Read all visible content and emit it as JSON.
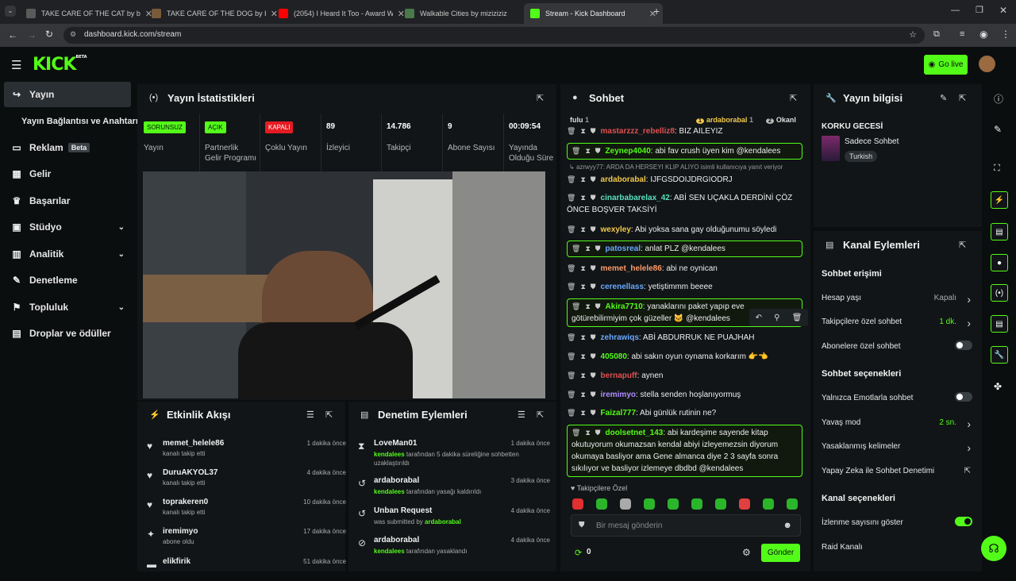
{
  "browser": {
    "tabs": [
      {
        "title": "TAKE CARE OF THE CAT by bo…",
        "color": "#5a5a5a"
      },
      {
        "title": "TAKE CARE OF THE DOG by bo…",
        "color": "#7a5a3a"
      },
      {
        "title": "(2054) I Heard It Too - Award W…",
        "color": "#ff0000"
      },
      {
        "title": "Walkable Cities by miziziziz",
        "color": "#4a7a4a"
      },
      {
        "title": "Stream - Kick Dashboard",
        "color": "#53fc18"
      }
    ],
    "url": "dashboard.kick.com/stream"
  },
  "header": {
    "logo": "KICK",
    "logo_beta": "BETA",
    "go_live": "Go live"
  },
  "sidebar": {
    "items": [
      {
        "label": "Yayın",
        "icon": "↪"
      },
      {
        "label": "Yayın Bağlantısı ve Anahtarı",
        "icon": ""
      },
      {
        "label": "Reklam",
        "icon": "▭",
        "badge": "Beta"
      },
      {
        "label": "Gelir",
        "icon": "▦"
      },
      {
        "label": "Başarılar",
        "icon": "♛"
      },
      {
        "label": "Stüdyo",
        "icon": "▣"
      },
      {
        "label": "Analitik",
        "icon": "▥"
      },
      {
        "label": "Denetleme",
        "icon": "✎"
      },
      {
        "label": "Topluluk",
        "icon": "⚑"
      },
      {
        "label": "Droplar ve ödüller",
        "icon": "▤"
      }
    ]
  },
  "stats": {
    "title": "Yayın İstatistikleri",
    "items": [
      {
        "badge": "SORUNSUZ",
        "label": "Yayın"
      },
      {
        "badge": "AÇIK",
        "label": "Partnerlik Gelir Programı"
      },
      {
        "badge": "KAPALI",
        "label": "Çoklu Yayın"
      },
      {
        "value": "89",
        "label": "İzleyici"
      },
      {
        "value": "14.786",
        "label": "Takipçi"
      },
      {
        "value": "9",
        "label": "Abone Sayısı"
      },
      {
        "value": "00:09:54",
        "label": "Yayında Olduğu Süre"
      }
    ]
  },
  "activity": {
    "title": "Etkinlik Akışı",
    "items": [
      {
        "icon": "♥",
        "name": "memet_helele86",
        "sub": "kanalı takip etti",
        "time": "1 dakika önce"
      },
      {
        "icon": "♥",
        "name": "DuruAKYOL37",
        "sub": "kanalı takip etti",
        "time": "4 dakika önce"
      },
      {
        "icon": "♥",
        "name": "toprakeren0",
        "sub": "kanalı takip etti",
        "time": "10 dakika önce"
      },
      {
        "icon": "✦",
        "name": "iremimyo",
        "sub": "abone oldu",
        "time": "17 dakika önce"
      },
      {
        "icon": "▬",
        "name": "elikfirik",
        "sub": "",
        "time": "51 dakika önce"
      }
    ]
  },
  "moderation": {
    "title": "Denetim Eylemleri",
    "items": [
      {
        "icon": "⧗",
        "name": "LoveMan01",
        "mod": "kendalees",
        "text": " tarafından 5 dakika süreliğine sohbetten uzaklaştırıldı",
        "time": "1 dakika önce"
      },
      {
        "icon": "↺",
        "name": "ardaborabal",
        "mod": "kendalees",
        "text": " tarafından yasağı kaldırıldı",
        "time": "3 dakika önce"
      },
      {
        "icon": "↺",
        "name": "Unban Request",
        "mod": "ardaborabal",
        "pre": "was submitted by ",
        "text": "",
        "time": "4 dakika önce"
      },
      {
        "icon": "⊘",
        "name": "ardaborabal",
        "mod": "kendalees",
        "text": " tarafından yasaklandı",
        "time": "4 dakika önce"
      }
    ]
  },
  "chat": {
    "title": "Sohbet",
    "top_user": "fulu",
    "top_count": "1",
    "gift1": "ardaborabal",
    "gift1_count": "1",
    "gift2": "Okanl",
    "reply_notice": "azrwyy77: ARDA DA HERSEYI KLIP ALIYO isimli kullanıcıya yanıt veriyor",
    "messages": [
      {
        "user": "mastarzzz_rebelliz8",
        "color": "#e05050",
        "text": ": BIZ AILEYIZ"
      },
      {
        "user": "Zeynep4040",
        "color": "#53fc18",
        "text": ": abi fav crush üyen kim @kendalees",
        "hl": true
      },
      {
        "user": "ardaborabal",
        "color": "#f2c94c",
        "text": ": IJFGSDOIJDRGIODRJ"
      },
      {
        "user": "cinarbabarelax_42",
        "color": "#5ae0c0",
        "text": ": ABİ SEN UÇAKLA DERDİNİ ÇÖZ ÖNCE BOŞVER TAKSİYİ"
      },
      {
        "user": "wexyley",
        "color": "#f2c94c",
        "text": ": Abi yoksa sana gay olduğunumu söyledi"
      },
      {
        "user": "patosreal",
        "color": "#6aa8ff",
        "text": ": anlat PLZ @kendalees",
        "hl": true
      },
      {
        "user": "memet_helele86",
        "color": "#ff9a6a",
        "text": ": abi ne oynican"
      },
      {
        "user": "cerenellass",
        "color": "#6aa8ff",
        "text": ": yetiştimmm beeee"
      },
      {
        "user": "Akira7710",
        "color": "#53fc18",
        "text": ": yanaklarını paket yapıp eve götürebilirmiyim çok güzeller 🐱 @kendalees",
        "hl": true
      },
      {
        "user": "zehrawiqs",
        "color": "#6aa8ff",
        "text": ": ABİ ABDURRUK NE PUAJHAH"
      },
      {
        "user": "405080",
        "color": "#53fc18",
        "text": ": abi sakın oyun oynama korkarım 👉👈"
      },
      {
        "user": "bernapuff",
        "color": "#e05050",
        "text": ": aynen"
      },
      {
        "user": "iremimyo",
        "color": "#b08cff",
        "text": ": stella senden hoşlanıyormuş"
      },
      {
        "user": "Faizal777",
        "color": "#53fc18",
        "text": ": Abi günlük rutinin ne?"
      },
      {
        "user": "doolsetnet_143",
        "color": "#53fc18",
        "text": ": abi kardeşime sayende kitap okutuyorum okumazsan kendal abiyi izleyemezsin diyorum okumaya basliyor ama Gene almanca diye 2 3 sayfa sonra sıkılıyor ve basliyor izlemeye dbdbd @kendalees",
        "hl": true
      }
    ],
    "followers_only": "Takipçilere Özel",
    "input_placeholder": "Bir mesaj gönderin",
    "points": "0",
    "send": "Gönder"
  },
  "stream_info": {
    "title": "Yayın bilgisi",
    "stream_title": "KORKU GECESİ",
    "category": "Sadece Sohbet",
    "tag": "Turkish"
  },
  "channel_actions": {
    "title": "Kanal Eylemleri",
    "sections": [
      {
        "heading": "Sohbet erişimi",
        "rows": [
          {
            "label": "Hesap yaşı",
            "value": "Kapalı",
            "kind": "chevron"
          },
          {
            "label": "Takipçilere özel sohbet",
            "value": "1 dk.",
            "kind": "chevron",
            "green": true
          },
          {
            "label": "Abonelere özel sohbet",
            "kind": "toggle",
            "on": false
          }
        ]
      },
      {
        "heading": "Sohbet seçenekleri",
        "rows": [
          {
            "label": "Yalnızca Emotlarla sohbet",
            "kind": "toggle",
            "on": false
          },
          {
            "label": "Yavaş mod",
            "value": "2 sn.",
            "kind": "chevron",
            "green": true
          },
          {
            "label": "Yasaklanmış kelimeler",
            "kind": "chevron"
          },
          {
            "label": "Yapay Zeka ile Sohbet Denetimi",
            "kind": "ext"
          }
        ]
      },
      {
        "heading": "Kanal seçenekleri",
        "rows": [
          {
            "label": "İzlenme sayısını göster",
            "kind": "toggle",
            "on": true
          },
          {
            "label": "Raid Kanalı",
            "kind": "none"
          }
        ]
      }
    ]
  }
}
